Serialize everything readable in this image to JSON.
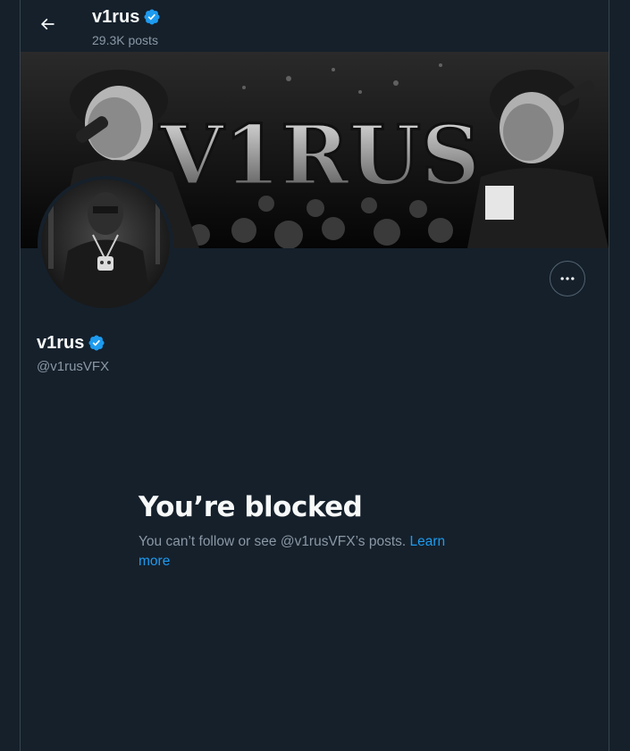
{
  "header": {
    "name": "v1rus",
    "posts": "29.3K posts",
    "back_icon": "arrow-left-icon"
  },
  "profile": {
    "name": "v1rus",
    "handle": "@v1rusVFX",
    "verified": true,
    "badge_color": "#1d9bf0"
  },
  "banner": {
    "text": "V1RUS"
  },
  "blocked": {
    "title": "You’re blocked",
    "message": "You can’t follow or see @v1rusVFX’s posts. ",
    "link": "Learn more"
  },
  "colors": {
    "background": "#15202b",
    "border": "#38444d",
    "text_primary": "#f7f9f9",
    "text_secondary": "#8b98a5",
    "accent": "#1d9bf0"
  }
}
